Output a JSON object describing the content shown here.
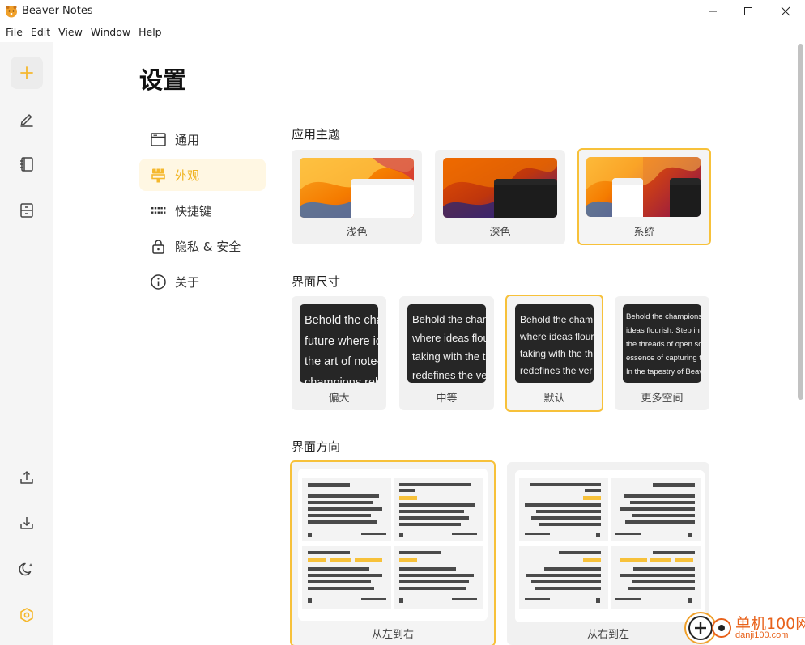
{
  "window": {
    "title": "Beaver Notes"
  },
  "menu": [
    "File",
    "Edit",
    "View",
    "Window",
    "Help"
  ],
  "page": {
    "title": "设置"
  },
  "nav": [
    {
      "label": "通用",
      "icon": "window-icon"
    },
    {
      "label": "外观",
      "icon": "paint-icon",
      "active": true
    },
    {
      "label": "快捷键",
      "icon": "keyboard-icon"
    },
    {
      "label": "隐私 & 安全",
      "icon": "lock-icon"
    },
    {
      "label": "关于",
      "icon": "info-icon"
    }
  ],
  "theme": {
    "title": "应用主题",
    "options": [
      {
        "label": "浅色"
      },
      {
        "label": "深色"
      },
      {
        "label": "系统",
        "selected": true
      }
    ]
  },
  "size": {
    "title": "界面尺寸",
    "options": [
      {
        "label": "偏大",
        "lines": [
          "Behold the cha",
          "future where id",
          "the art of note-",
          "champions reh"
        ]
      },
      {
        "label": "中等",
        "lines": [
          "Behold the chan",
          "where ideas flou",
          "taking with the t",
          "redefines the ve"
        ]
      },
      {
        "label": "默认",
        "selected": true,
        "lines": [
          "Behold the cham",
          "where ideas flour",
          "taking with the th",
          "redefines the ver"
        ]
      },
      {
        "label": "更多空间",
        "lines": [
          "Behold the champions",
          "ideas flourish. Step in",
          "the threads of open so",
          "essence of capturing t",
          "In the tapestry of Beav"
        ]
      }
    ]
  },
  "direction": {
    "title": "界面方向",
    "options": [
      {
        "label": "从左到右",
        "selected": true
      },
      {
        "label": "从右到左"
      }
    ]
  },
  "watermark": {
    "text": "单机100网",
    "domain": "danji100.com"
  },
  "colors": {
    "accent": "#f7c13a",
    "rail_bg": "#f5f5f5",
    "card_bg": "#f1f1f1"
  }
}
